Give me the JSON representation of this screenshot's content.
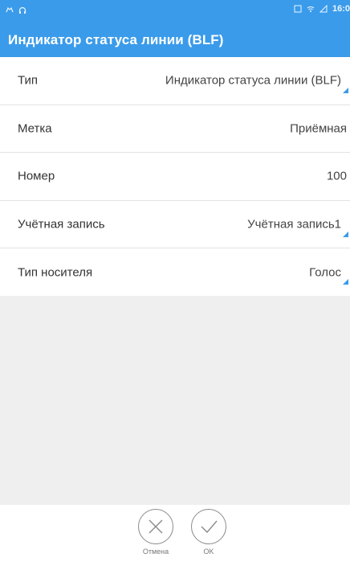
{
  "status_bar": {
    "time": "16:0",
    "icons": [
      "voicemail-icon",
      "headset-icon",
      "sim-icon",
      "wifi-icon",
      "signal-icon"
    ]
  },
  "header": {
    "title": "Индикатор статуса линии (BLF)",
    "color": "#3a9bea"
  },
  "fields": [
    {
      "label": "Тип",
      "value": "Индикатор статуса линии (BLF)",
      "dropdown": true
    },
    {
      "label": "Метка",
      "value": "Приёмная",
      "dropdown": false
    },
    {
      "label": "Номер",
      "value": "100",
      "dropdown": false
    },
    {
      "label": "Учётная запись",
      "value": "Учётная запись1",
      "dropdown": true
    },
    {
      "label": "Тип носителя",
      "value": "Голос",
      "dropdown": true
    }
  ],
  "buttons": {
    "cancel_label": "Отмена",
    "ok_label": "OK"
  }
}
